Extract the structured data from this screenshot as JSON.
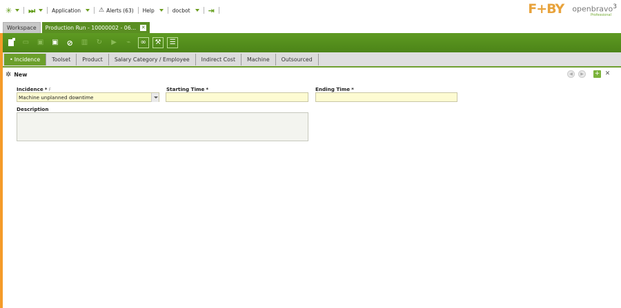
{
  "topnav": {
    "workspace_glyph": "✳",
    "quick_launch_glyph": "⏭",
    "application_label": "Application",
    "alerts_label": "Alerts (63)",
    "help_label": "Help",
    "user_label": "docbot",
    "logout_glyph": "⇥"
  },
  "logos": {
    "brand1": "F+BY",
    "brand2": "openbravo",
    "brand2_version": "3",
    "brand2_edition": "Professional"
  },
  "tabs": {
    "workspace": "Workspace",
    "active": "Production Run - 10000002 - 06...",
    "close_glyph": "✕"
  },
  "toolbar": {
    "buttons": [
      "new-document",
      "new-row",
      "save",
      "save-close",
      "undo",
      "delete",
      "refresh",
      "export",
      "attachments",
      "link",
      "tools",
      "grid-view"
    ]
  },
  "subtabs": [
    "Incidence",
    "Toolset",
    "Product",
    "Salary Category / Employee",
    "Indirect Cost",
    "Machine",
    "Outsourced"
  ],
  "form": {
    "header_title": "New",
    "incidence_label": "Incidence",
    "incidence_value": "Machine unplanned downtime",
    "required_marker": "*",
    "filter_marker": "F",
    "starting_time_label": "Starting Time",
    "starting_time_value": "",
    "ending_time_label": "Ending Time",
    "ending_time_value": "",
    "description_label": "Description",
    "description_value": ""
  },
  "colors": {
    "toolbar_green": "#5a8e22",
    "accent_orange": "#f59b29",
    "required_field_bg": "#fdfbd2"
  }
}
